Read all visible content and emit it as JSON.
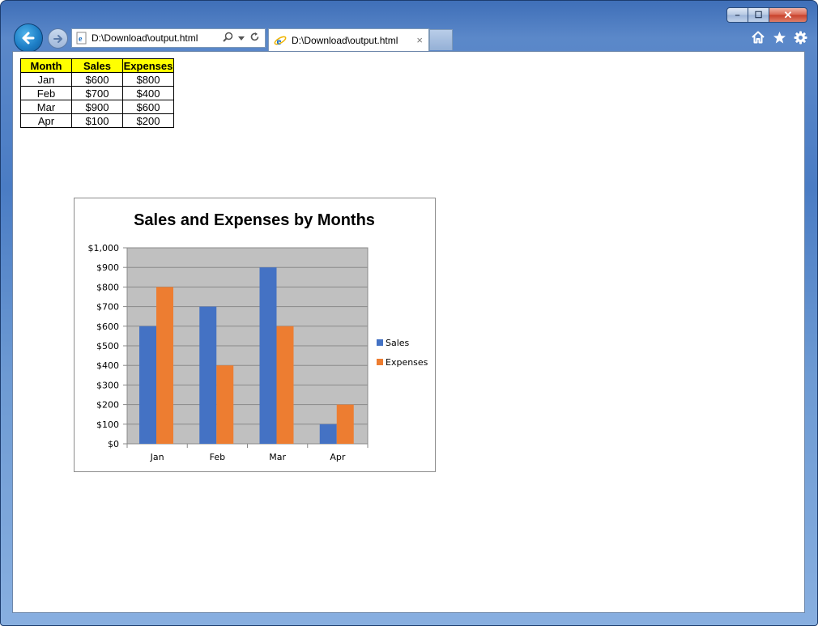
{
  "browser": {
    "address": "D:\\Download\\output.html",
    "tab_title": "D:\\Download\\output.html",
    "tab_close": "×",
    "window_controls": {
      "minimize": "–",
      "maximize": "☐",
      "close": "✕"
    },
    "icons": [
      "back-arrow-icon",
      "forward-arrow-icon",
      "page-icon",
      "search-icon",
      "dropdown-icon",
      "refresh-icon",
      "ie-icon",
      "home-icon",
      "star-icon",
      "gear-icon"
    ]
  },
  "table": {
    "headers": [
      "Month",
      "Sales",
      "Expenses"
    ],
    "rows": [
      [
        "Jan",
        "$600",
        "$800"
      ],
      [
        "Feb",
        "$700",
        "$400"
      ],
      [
        "Mar",
        "$900",
        "$600"
      ],
      [
        "Apr",
        "$100",
        "$200"
      ]
    ],
    "header_bg": "#ffff00"
  },
  "chart_data": {
    "type": "bar",
    "title": "Sales and Expenses by Months",
    "categories": [
      "Jan",
      "Feb",
      "Mar",
      "Apr"
    ],
    "series": [
      {
        "name": "Sales",
        "values": [
          600,
          700,
          900,
          100
        ],
        "color": "#4472c4"
      },
      {
        "name": "Expenses",
        "values": [
          800,
          400,
          600,
          200
        ],
        "color": "#ed7d31"
      }
    ],
    "ylim": [
      0,
      1000
    ],
    "yticks": [
      0,
      100,
      200,
      300,
      400,
      500,
      600,
      700,
      800,
      900,
      1000
    ],
    "ytick_labels": [
      "$0",
      "$100",
      "$200",
      "$300",
      "$400",
      "$500",
      "$600",
      "$700",
      "$800",
      "$900",
      "$1,000"
    ],
    "plot_background": "#c0c0c0",
    "grid": true,
    "legend": "right"
  }
}
